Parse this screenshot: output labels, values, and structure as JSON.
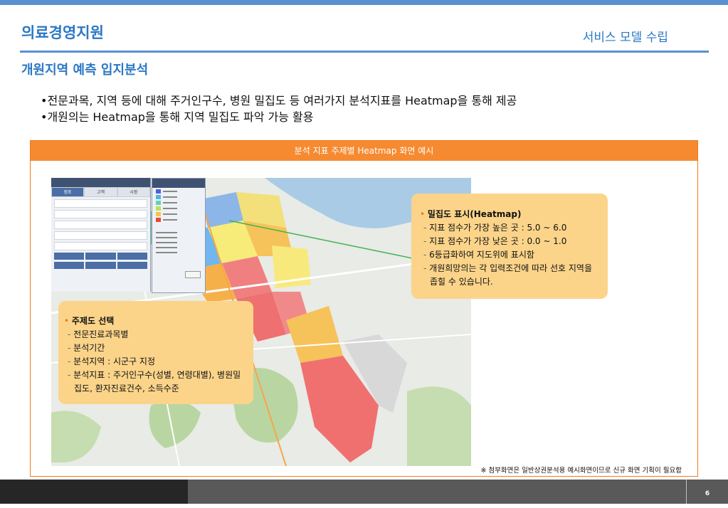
{
  "header": {
    "title": "의료경영지원",
    "section": "서비스 모델 수립",
    "subtitle": "개원지역 예측 입지분석"
  },
  "bullets": [
    "전문과목, 지역 등에 대해 주거인구수, 병원 밀집도 등 여러가지 분석지표를 Heatmap을 통해 제공",
    "개원의는 Heatmap을 통해 지역 밀집도 파악 가능 활용"
  ],
  "frame": {
    "heading": "분석 지표 주제별 Heatmap 화면 예시",
    "footnote": "※ 첨부화면은 일반상권분석용 예시화면이므로 신규 화면 기획이 필요함"
  },
  "panel_right": {
    "title": "밀집도 표시(Heatmap)",
    "items": [
      "지표 점수가 가장 높은 곳 : 5.0 ~ 6.0",
      "지표 점수가 가장 낮은 곳 : 0.0 ~ 1.0",
      "6등급화하여 지도위에 표시함",
      "개원희망의는 각 입력조건에 따라 선호 지역을 좁힐 수 있습니다."
    ]
  },
  "panel_left": {
    "title": "주제도 선택",
    "items": [
      "전문진료과목별",
      "분석기간",
      "분석지역 : 시군구 지정",
      "분석지표 : 주거인구수(성별, 연령대별), 병원밀집도, 환자진료건수, 소득수준"
    ]
  },
  "map": {
    "legend_colors": [
      "#4a63d8",
      "#57b0e6",
      "#5fd3b8",
      "#bde05a",
      "#f5c54a",
      "#e8463f"
    ],
    "tabs": [
      "점포",
      "고객",
      "시장"
    ]
  },
  "footer": {
    "page_number": "6"
  }
}
